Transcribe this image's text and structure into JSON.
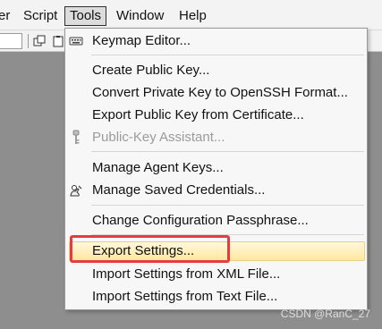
{
  "menubar": {
    "items": [
      {
        "label": "er"
      },
      {
        "label": "Script"
      },
      {
        "label": "Tools"
      },
      {
        "label": "Window"
      },
      {
        "label": "Help"
      }
    ]
  },
  "toolbar": {
    "icons": [
      "duplicate-window-icon",
      "clipboard-icon"
    ]
  },
  "tools_menu": {
    "items": [
      {
        "label": "Keymap Editor...",
        "icon": "keyboard-icon"
      },
      {
        "label": "Create Public Key..."
      },
      {
        "label": "Convert Private Key to OpenSSH Format..."
      },
      {
        "label": "Export Public Key from Certificate..."
      },
      {
        "label": "Public-Key Assistant...",
        "icon": "key-icon",
        "disabled": true
      },
      {
        "label": "Manage Agent Keys..."
      },
      {
        "label": "Manage Saved Credentials...",
        "icon": "credentials-icon"
      },
      {
        "label": "Change Configuration Passphrase..."
      },
      {
        "label": "Export Settings...",
        "highlighted": true
      },
      {
        "label": "Import Settings from XML File..."
      },
      {
        "label": "Import Settings from Text File..."
      }
    ]
  },
  "watermark": {
    "text": "CSDN @RanC_27"
  },
  "colors": {
    "menu_highlight": "#ffe79e",
    "annotation_red": "#e53d3d",
    "background": "#8e8e8e",
    "disabled_text": "#9b9b9b"
  }
}
